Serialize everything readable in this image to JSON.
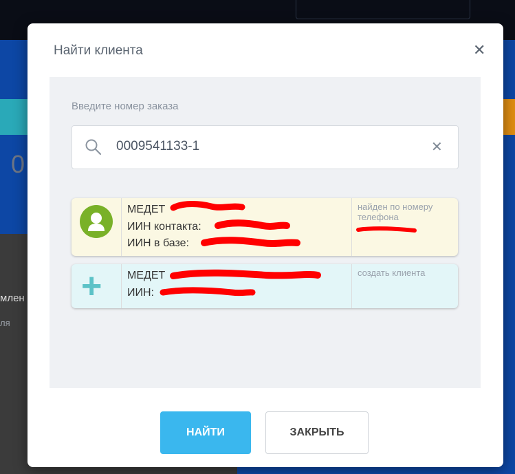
{
  "background": {
    "big_number": "0",
    "text1": "млен",
    "text2": "ля"
  },
  "modal": {
    "title": "Найти клиента",
    "close_icon": "close-icon",
    "field_label": "Введите номер заказа",
    "search": {
      "icon": "search-icon",
      "value": "0009541133-1",
      "clear_icon": "clear-icon"
    },
    "results": [
      {
        "icon": "person-icon",
        "lines": [
          "МЕДЕТ",
          "ИИН контакта:",
          "ИИН в базе:"
        ],
        "note": "найден по номеру телефона",
        "bg_color": "#fbf8e3"
      },
      {
        "icon": "plus-icon",
        "lines": [
          "МЕДЕТ",
          "ИИН:"
        ],
        "note": "создать клиента",
        "bg_color": "#e3f6f8"
      }
    ],
    "buttons": {
      "find": "НАЙТИ",
      "close": "ЗАКРЫТЬ"
    }
  },
  "colors": {
    "accent": "#3ab7ee",
    "redaction": "#ff0000"
  }
}
